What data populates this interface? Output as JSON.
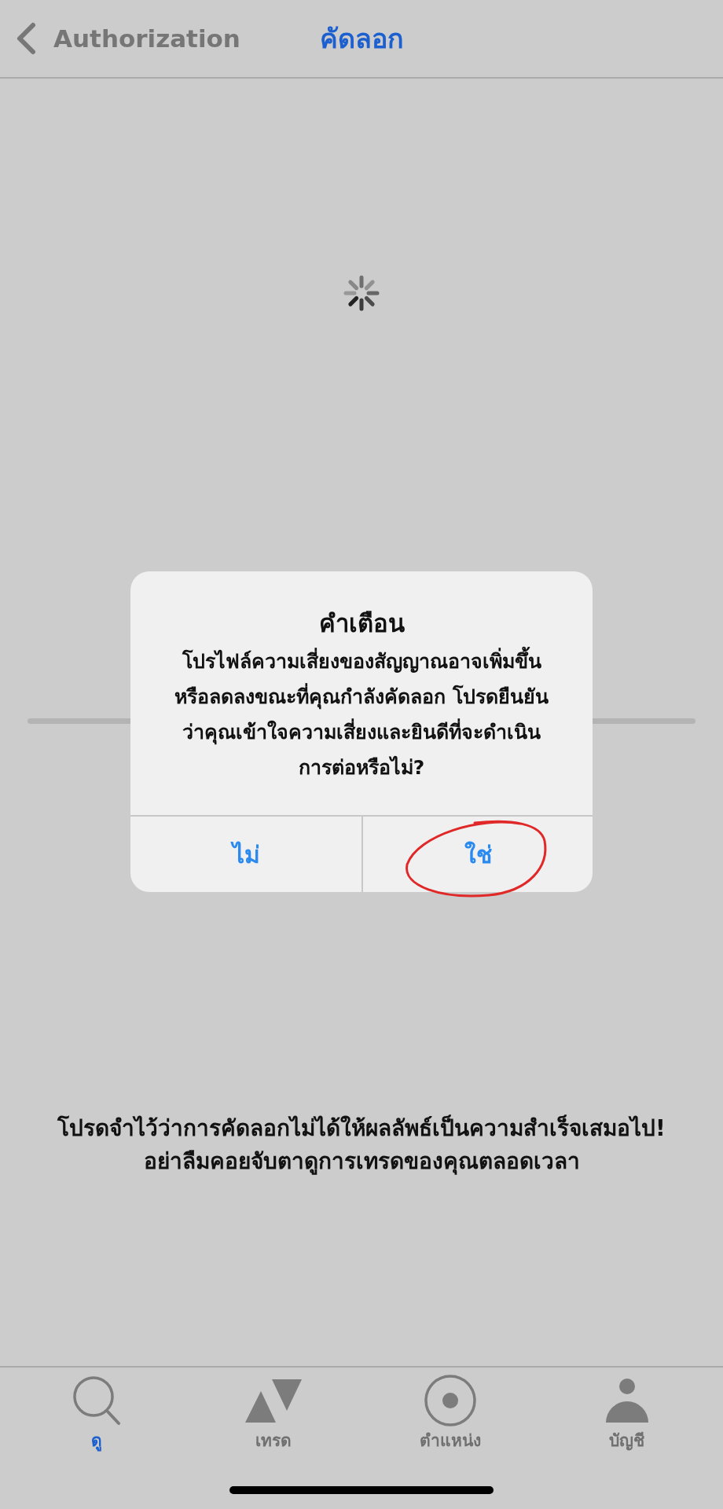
{
  "nav_bar": {
    "back_label": "Authorization",
    "title": "คัดลอก"
  },
  "alert": {
    "title": "คำเตือน",
    "message": "โปรไฟล์ความเสี่ยงของสัญญาณอาจเพิ่มขึ้น\nหรือลดลงขณะที่คุณกำลังคัดลอก โปรดยืนยัน\nว่าคุณเข้าใจความเสี่ยงและยินดีที่จะดำเนิน\nการต่อหรือไม่?",
    "buttons": [
      {
        "label": "ไม่"
      },
      {
        "label": "ใช่"
      }
    ]
  },
  "notice": "โปรดจำไว้ว่าการคัดลอกไม่ได้ให้ผลลัพธ์เป็นความสำเร็จเสมอไป!\nอย่าลืมคอยจับตาดูการเทรดของคุณตลอดเวลา",
  "tab_bar": [
    {
      "label": "ดู",
      "kind": "search",
      "selected": true
    },
    {
      "label": "เทรด",
      "kind": "trade",
      "selected": false
    },
    {
      "label": "ตำแหน่ง",
      "kind": "position",
      "selected": false
    },
    {
      "label": "บัญชี",
      "kind": "account",
      "selected": false
    }
  ]
}
